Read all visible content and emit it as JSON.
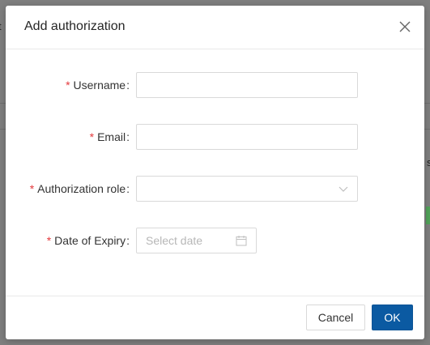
{
  "background": {
    "left_fragment": "t",
    "right_fragment": "s"
  },
  "modal": {
    "title": "Add authorization",
    "close_icon": "close-icon"
  },
  "form": {
    "required_mark": "*",
    "fields": [
      {
        "label": "Username",
        "value": "",
        "type": "text"
      },
      {
        "label": "Email",
        "value": "",
        "type": "text"
      },
      {
        "label": "Authorization role",
        "value": "",
        "type": "select",
        "icon": "chevron-down-icon"
      },
      {
        "label": "Date of Expiry",
        "placeholder": "Select date",
        "type": "date",
        "icon": "calendar-icon"
      }
    ]
  },
  "footer": {
    "cancel_label": "Cancel",
    "ok_label": "OK"
  },
  "colors": {
    "primary": "#0b5aa2",
    "required": "#e4393c",
    "border": "#d9d9d9"
  }
}
